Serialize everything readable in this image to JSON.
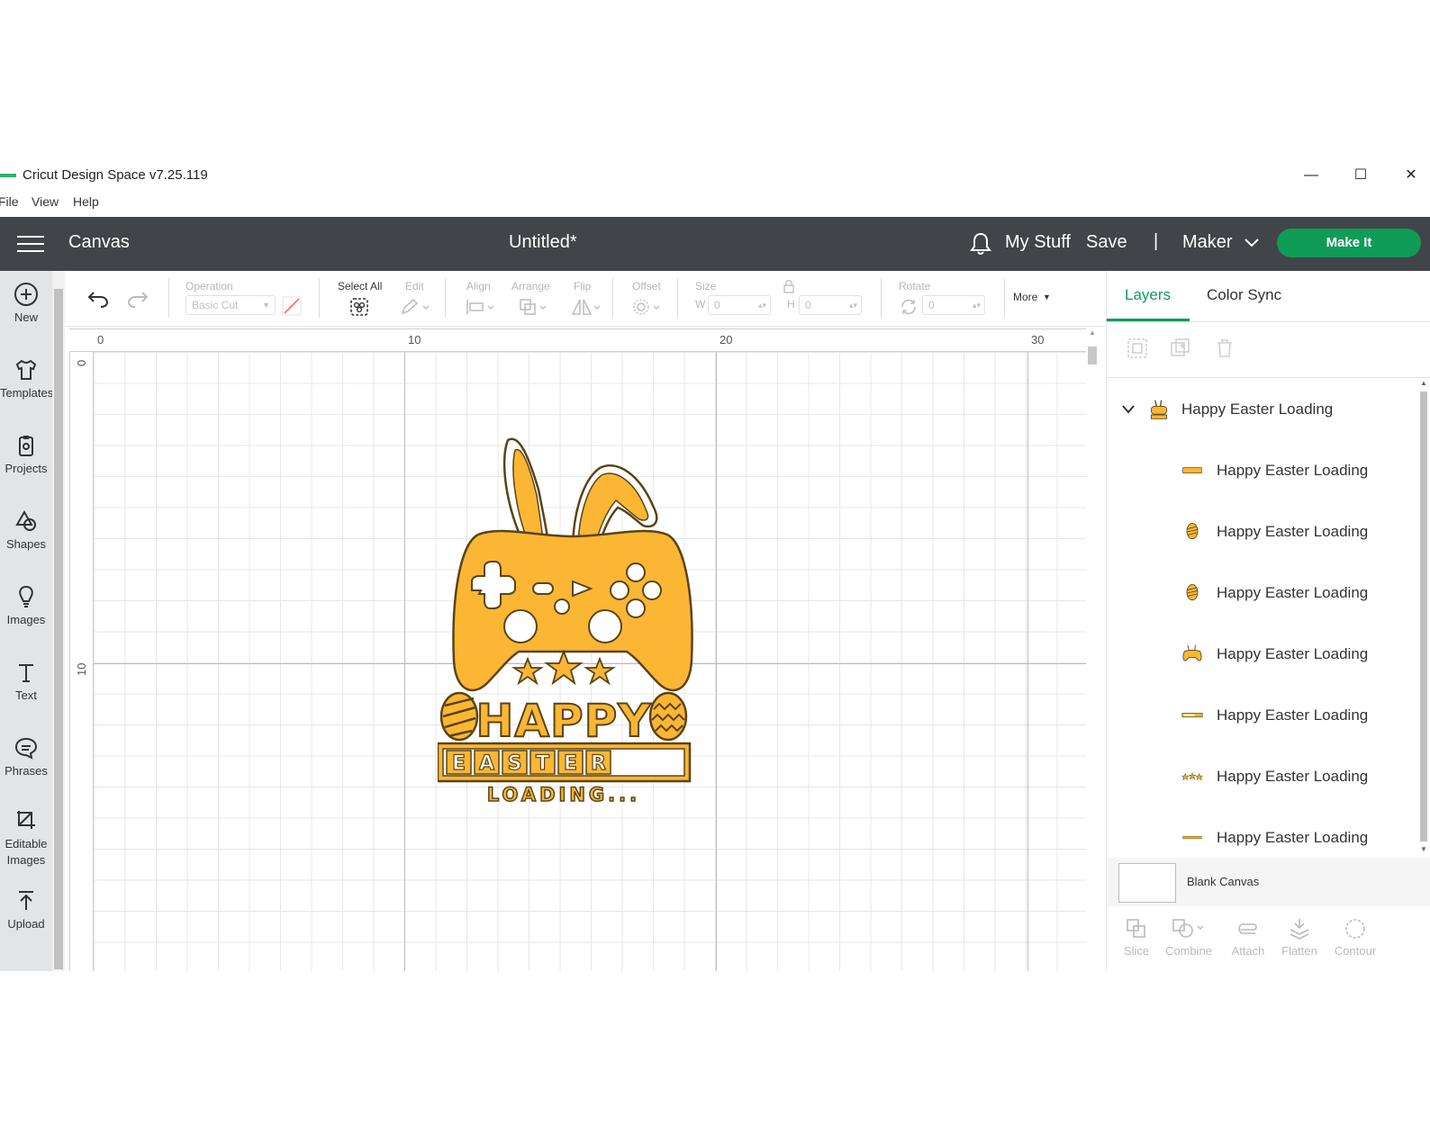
{
  "window": {
    "title": "Cricut Design Space  v7.25.119",
    "minimize": "—",
    "maximize": "☐",
    "close": "✕"
  },
  "menu": {
    "file": "File",
    "view": "View",
    "help": "Help"
  },
  "header": {
    "section": "Canvas",
    "document": "Untitled*",
    "my_stuff": "My Stuff",
    "save": "Save",
    "separator": "|",
    "machine": "Maker",
    "make_it": "Make It",
    "accent": "#0f9c57",
    "bg": "#414449"
  },
  "sidebar": {
    "items": [
      {
        "label": "New",
        "icon": "plus-circle-icon"
      },
      {
        "label": "Templates",
        "icon": "shirt-icon"
      },
      {
        "label": "Projects",
        "icon": "clipboard-icon"
      },
      {
        "label": "Shapes",
        "icon": "shapes-icon"
      },
      {
        "label": "Images",
        "icon": "bulb-icon"
      },
      {
        "label": "Text",
        "icon": "text-icon"
      },
      {
        "label": "Phrases",
        "icon": "speech-icon"
      },
      {
        "label": "Editable Images",
        "icon": "crop-icon"
      },
      {
        "label": "Upload",
        "icon": "upload-icon"
      }
    ]
  },
  "toolbar": {
    "operation_label": "Operation",
    "operation_value": "Basic Cut",
    "select_all": "Select All",
    "edit": "Edit",
    "align": "Align",
    "arrange": "Arrange",
    "flip": "Flip",
    "offset": "Offset",
    "size": "Size",
    "w_label": "W",
    "w_value": "0",
    "h_label": "H",
    "h_value": "0",
    "rotate": "Rotate",
    "rotate_value": "0",
    "more": "More"
  },
  "rulers": {
    "top": [
      "0",
      "10",
      "20",
      "30"
    ],
    "left": [
      "0",
      "10"
    ]
  },
  "design": {
    "title_word": "HAPPY",
    "easter_letters": [
      "E",
      "A",
      "S",
      "T",
      "E",
      "R"
    ],
    "loading": "LOADING...",
    "fill": "#fbb634",
    "stroke": "#5a4416"
  },
  "panel": {
    "tabs": {
      "layers": "Layers",
      "color_sync": "Color Sync"
    },
    "group_name": "Happy Easter Loading",
    "layers": [
      {
        "name": "Happy Easter Loading",
        "thumb": "happy-text"
      },
      {
        "name": "Happy Easter Loading",
        "thumb": "egg"
      },
      {
        "name": "Happy Easter Loading",
        "thumb": "egg"
      },
      {
        "name": "Happy Easter Loading",
        "thumb": "controller"
      },
      {
        "name": "Happy Easter Loading",
        "thumb": "bar"
      },
      {
        "name": "Happy Easter Loading",
        "thumb": "stars"
      },
      {
        "name": "Happy Easter Loading",
        "thumb": "loading-text"
      }
    ],
    "blank_canvas": "Blank Canvas",
    "bottom_tools": [
      "Slice",
      "Combine",
      "Attach",
      "Flatten",
      "Contour"
    ]
  }
}
